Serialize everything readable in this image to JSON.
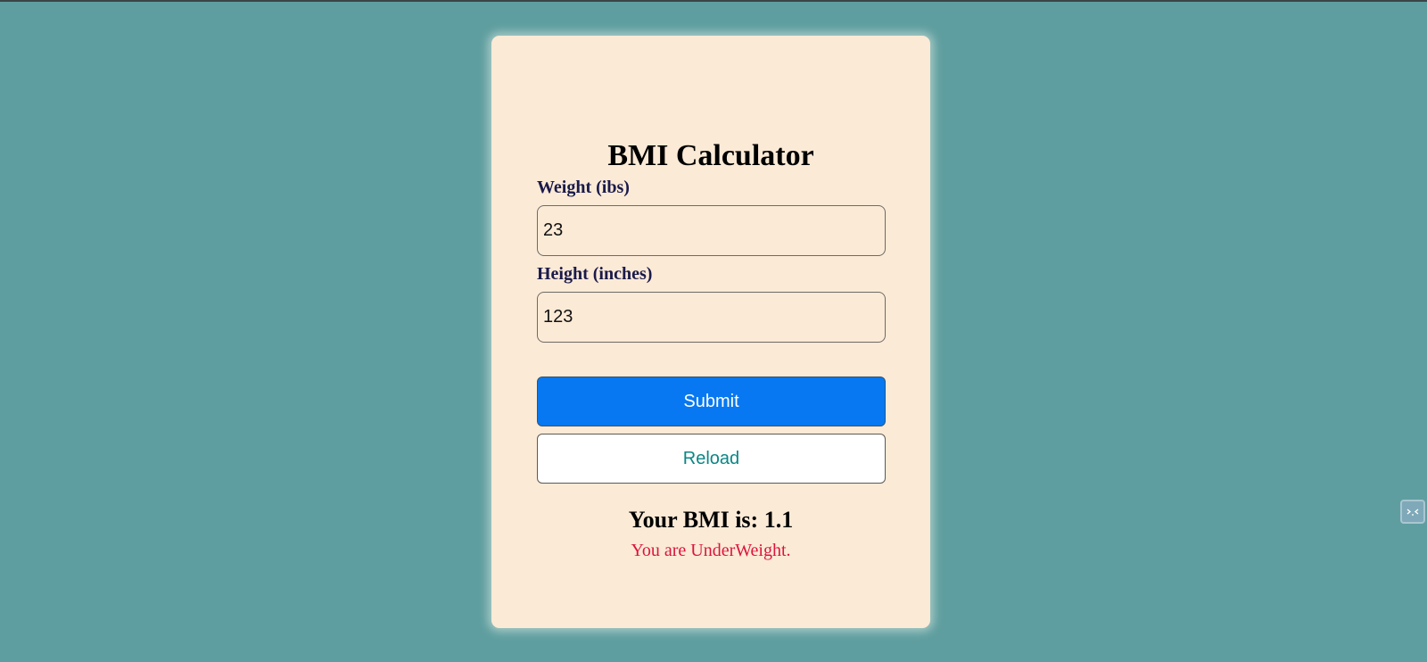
{
  "app": {
    "title": "BMI Calculator"
  },
  "form": {
    "weight": {
      "label": "Weight (ibs)",
      "value": "23"
    },
    "height": {
      "label": "Height (inches)",
      "value": "123"
    },
    "submit_label": "Submit",
    "reload_label": "Reload"
  },
  "result": {
    "bmi_text": "Your BMI is: 1.1",
    "status_text": "You are UnderWeight."
  },
  "widget": {
    "icon": "collapse-icon"
  },
  "colors": {
    "page_background": "#5f9ea0",
    "card_background": "#fbead6",
    "submit_button": "#0778f1",
    "reload_text": "#0a8686",
    "status_text": "#dc143c",
    "label_text": "#1a1a4b"
  }
}
